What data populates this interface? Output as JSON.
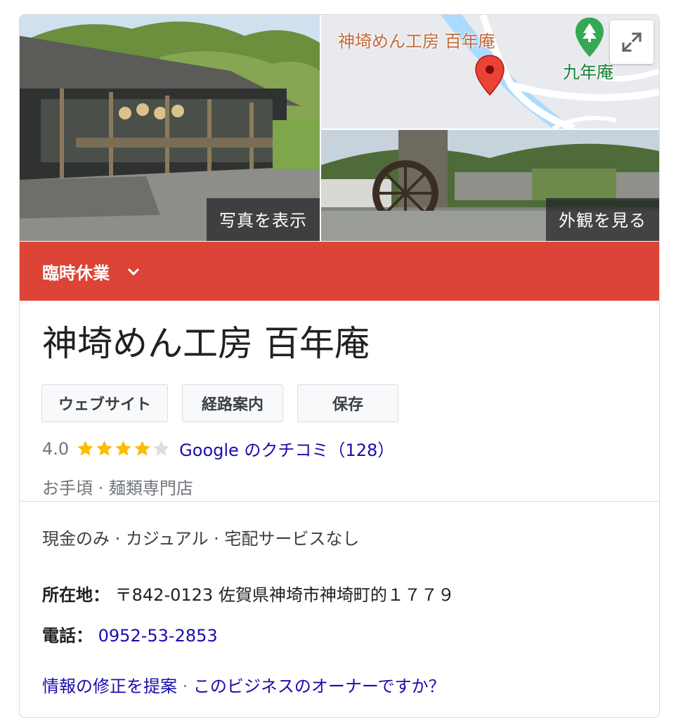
{
  "media": {
    "photos_button_label": "写真を表示",
    "street_view_button_label": "外観を見る",
    "map_place_label": "神埼めん工房 百年庵",
    "map_poi_label": "九年庵",
    "expand_icon": "expand-icon",
    "pin_icon": "map-pin-icon",
    "poi_icon": "tree-icon"
  },
  "status": {
    "label": "臨時休業",
    "chevron_icon": "chevron-down-icon",
    "color": "#db4437"
  },
  "place": {
    "title": "神埼めん工房 百年庵",
    "actions": [
      {
        "label": "ウェブサイト"
      },
      {
        "label": "経路案内"
      },
      {
        "label": "保存"
      }
    ],
    "rating": "4.0",
    "rating_value": 4.0,
    "rating_max": 5,
    "reviews_link": "Google のクチコミ（128）",
    "price_level": "お手頃",
    "separator": " · ",
    "category": "麺類専門店",
    "attributes": "現金のみ · カジュアル · 宅配サービスなし",
    "address_label": "所在地：",
    "address_value": "〒842-0123 佐賀県神埼市神埼町的１７７９",
    "phone_label": "電話：",
    "phone_value": "0952-53-2853"
  },
  "footer": {
    "suggest_edit": "情報の修正を提案",
    "separator": " · ",
    "owner_question": "このビジネスのオーナーですか？"
  },
  "colors": {
    "link": "#1a0dab",
    "star": "#fbbc04",
    "star_empty": "#dadce0",
    "pin": "#ea4335"
  }
}
